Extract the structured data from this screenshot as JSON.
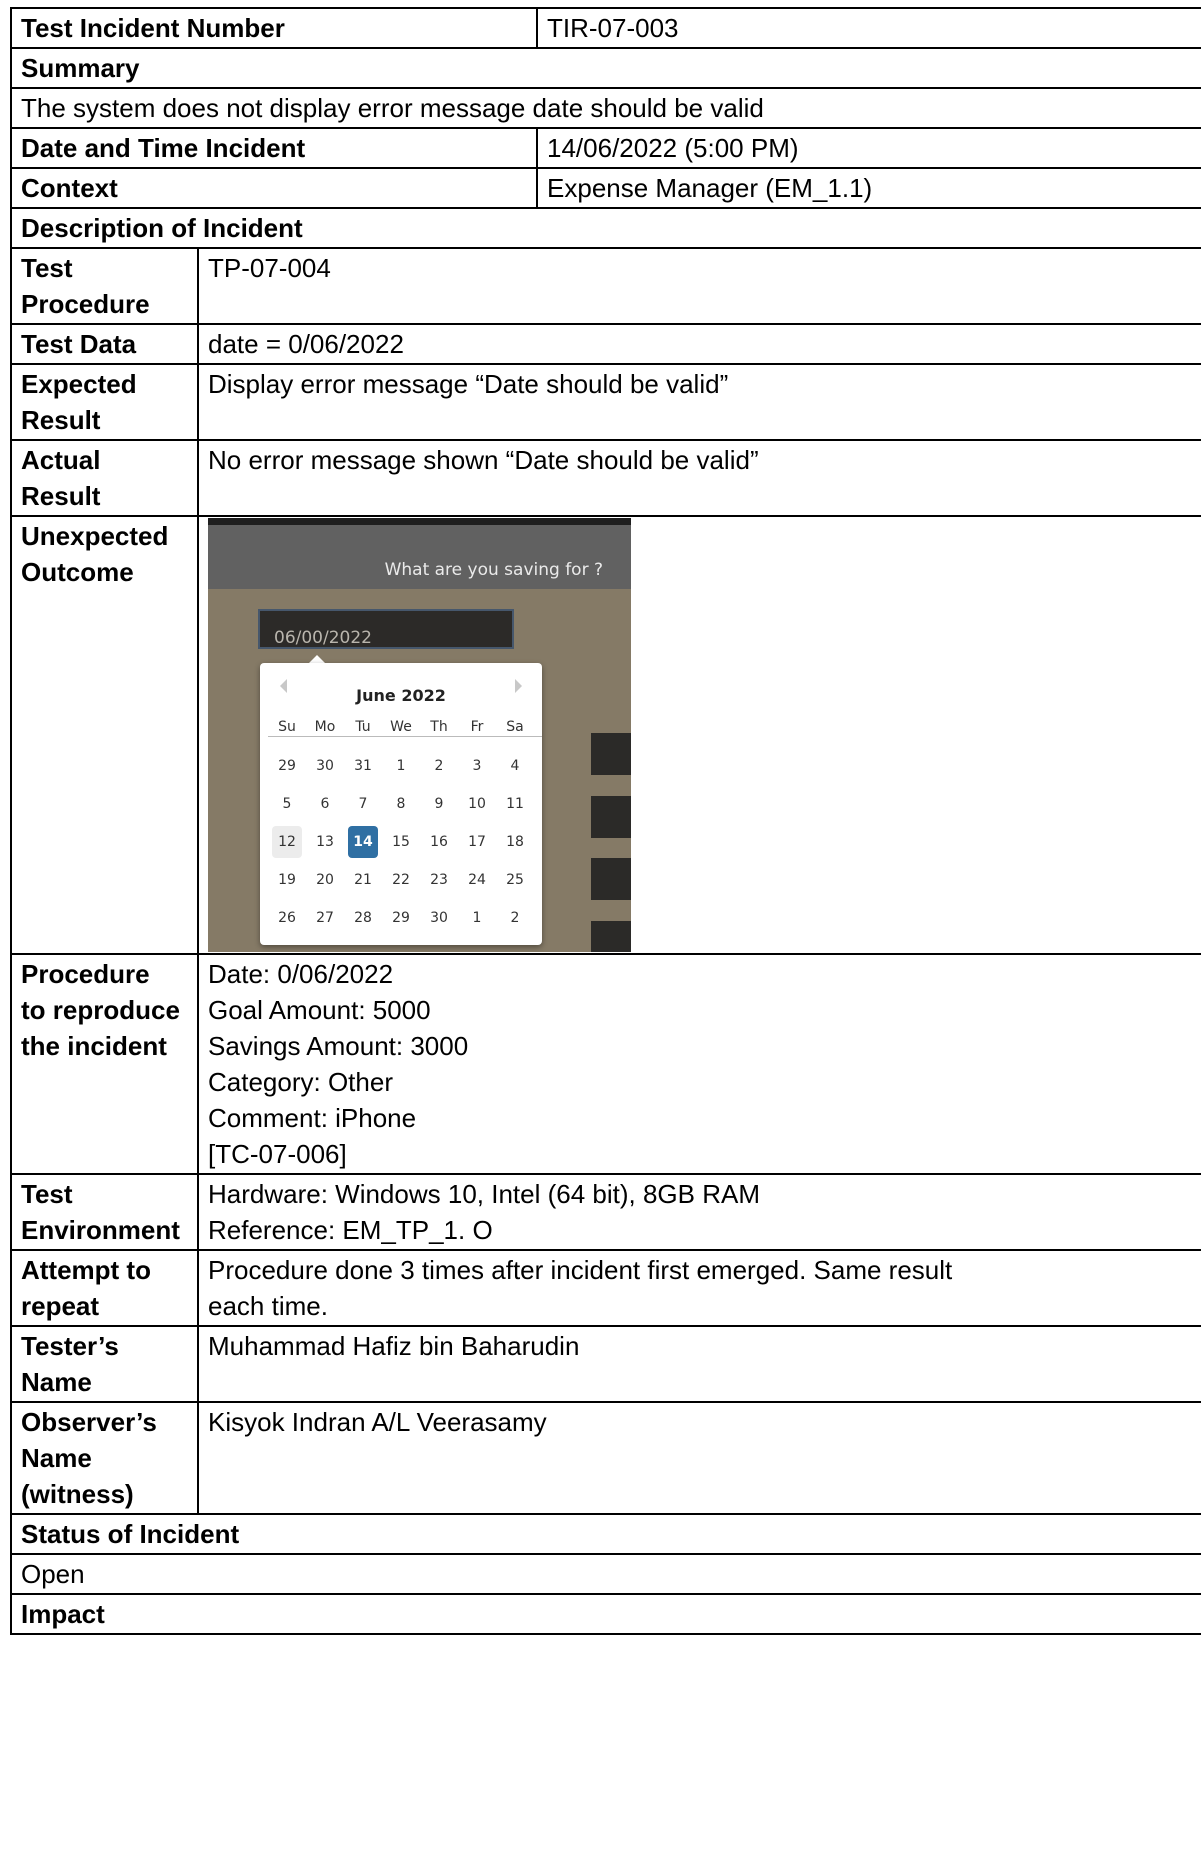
{
  "report": {
    "incident_number_label": "Test Incident Number",
    "incident_number_value": "TIR-07-003",
    "summary_label": "Summary",
    "summary_text": "The system does not display error message date should be valid",
    "datetime_label": "Date and Time Incident",
    "datetime_value": "14/06/2022 (5:00 PM)",
    "context_label": "Context",
    "context_value": "Expense Manager (EM_1.1)",
    "description_label": "Description of Incident",
    "test_procedure_label": [
      "Test",
      "Procedure"
    ],
    "test_procedure_value": "TP-07-004",
    "test_data_label": "Test Data",
    "test_data_value": "date = 0/06/2022",
    "expected_label": [
      "Expected",
      "Result"
    ],
    "expected_value": "Display error message “Date should be valid”",
    "actual_label": [
      "Actual",
      "Result"
    ],
    "actual_value": "No error message shown “Date should be valid”",
    "unexpected_label": [
      "Unexpected",
      "Outcome"
    ],
    "reproduce_label": [
      "Procedure",
      "to reproduce",
      "the incident"
    ],
    "reproduce_lines": [
      "Date: 0/06/2022",
      "Goal Amount: 5000",
      "Savings Amount: 3000",
      "Category: Other",
      "Comment: iPhone",
      "[TC-07-006]"
    ],
    "environment_label": [
      "Test",
      "Environment"
    ],
    "environment_lines": [
      "Hardware: Windows 10, Intel (64 bit), 8GB RAM",
      "Reference: EM_TP_1. O"
    ],
    "attempt_label": [
      "Attempt to",
      "repeat"
    ],
    "attempt_lines": [
      "Procedure done 3 times after incident first emerged. Same result",
      "each time."
    ],
    "tester_label": [
      "Tester’s",
      "Name"
    ],
    "tester_value": "Muhammad Hafiz bin Baharudin",
    "observer_label": [
      "Observer’s",
      "Name",
      "(witness)"
    ],
    "observer_value": "Kisyok Indran A/L Veerasamy",
    "status_label": "Status of Incident",
    "status_value": "Open",
    "impact_label": "Impact"
  },
  "screenshot": {
    "header_text": "What are you saving for ?",
    "date_input_value": "06/00/2022",
    "calendar": {
      "month_label": "June 2022",
      "weekdays": [
        "Su",
        "Mo",
        "Tu",
        "We",
        "Th",
        "Fr",
        "Sa"
      ],
      "days": [
        "29",
        "30",
        "31",
        "1",
        "2",
        "3",
        "4",
        "5",
        "6",
        "7",
        "8",
        "9",
        "10",
        "11",
        "12",
        "13",
        "14",
        "15",
        "16",
        "17",
        "18",
        "19",
        "20",
        "21",
        "22",
        "23",
        "24",
        "25",
        "26",
        "27",
        "28",
        "29",
        "30",
        "1",
        "2"
      ],
      "highlighted_day": "12",
      "selected_day": "14",
      "selected_color": "#2f6fa3"
    }
  }
}
